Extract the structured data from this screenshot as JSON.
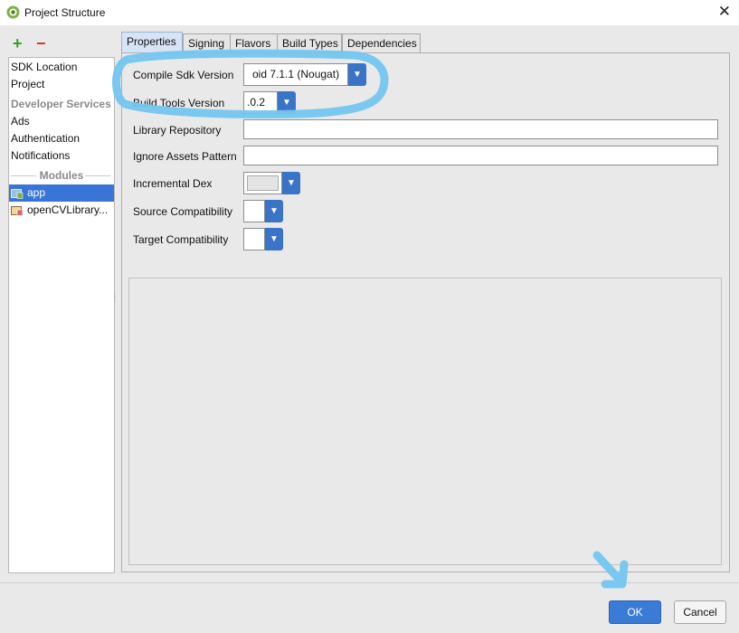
{
  "window": {
    "title": "Project Structure",
    "close_glyph": "✕",
    "icon": "android-studio-icon"
  },
  "toolbar": {
    "add_glyph": "+",
    "remove_glyph": "−"
  },
  "sidebar": {
    "items": [
      "SDK Location",
      "Project"
    ],
    "developer_services_header": "Developer Services",
    "service_items": [
      "Ads",
      "Authentication",
      "Notifications"
    ],
    "modules_header": "Modules",
    "modules": [
      "app",
      "openCVLibrary..."
    ],
    "selected_module": "app"
  },
  "tabs": [
    "Properties",
    "Signing",
    "Flavors",
    "Build Types",
    "Dependencies"
  ],
  "active_tab": "Properties",
  "form": {
    "compile_sdk": {
      "label": "Compile Sdk Version",
      "value": "oid 7.1.1 (Nougat)"
    },
    "build_tools": {
      "label": "Build Tools Version",
      "value": ".0.2"
    },
    "library_repository": {
      "label": "Library Repository",
      "value": ""
    },
    "ignore_assets": {
      "label": "Ignore Assets Pattern",
      "value": ""
    },
    "incremental_dex": {
      "label": "Incremental Dex",
      "value": ""
    },
    "source_compat": {
      "label": "Source Compatibility",
      "value": ""
    },
    "target_compat": {
      "label": "Target Compatibility",
      "value": ""
    }
  },
  "buttons": {
    "ok": "OK",
    "cancel": "Cancel",
    "dropdown_glyph": "▼"
  },
  "colors": {
    "accent": "#3a74c8",
    "selection": "#3875d7",
    "annotation": "#74c6ef"
  }
}
